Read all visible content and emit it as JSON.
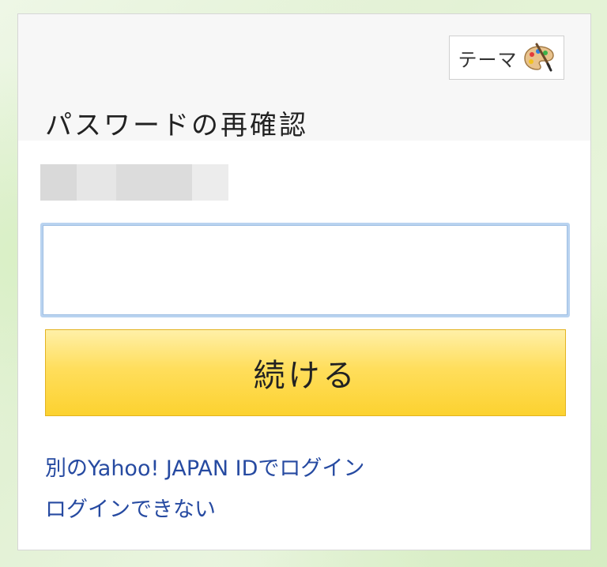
{
  "theme_button": {
    "label": "テーマ",
    "icon": "palette-icon"
  },
  "page_title": "パスワードの再確認",
  "user_id_masked": "",
  "password_input": {
    "value": "",
    "placeholder": ""
  },
  "continue_button": {
    "label": "続ける"
  },
  "links": {
    "other_id": "別のYahoo! JAPAN IDでログイン",
    "cannot_login": "ログインできない"
  },
  "colors": {
    "accent_button": "#ffd83b",
    "link": "#264aa1",
    "input_focus_border": "#b9d3f0"
  }
}
